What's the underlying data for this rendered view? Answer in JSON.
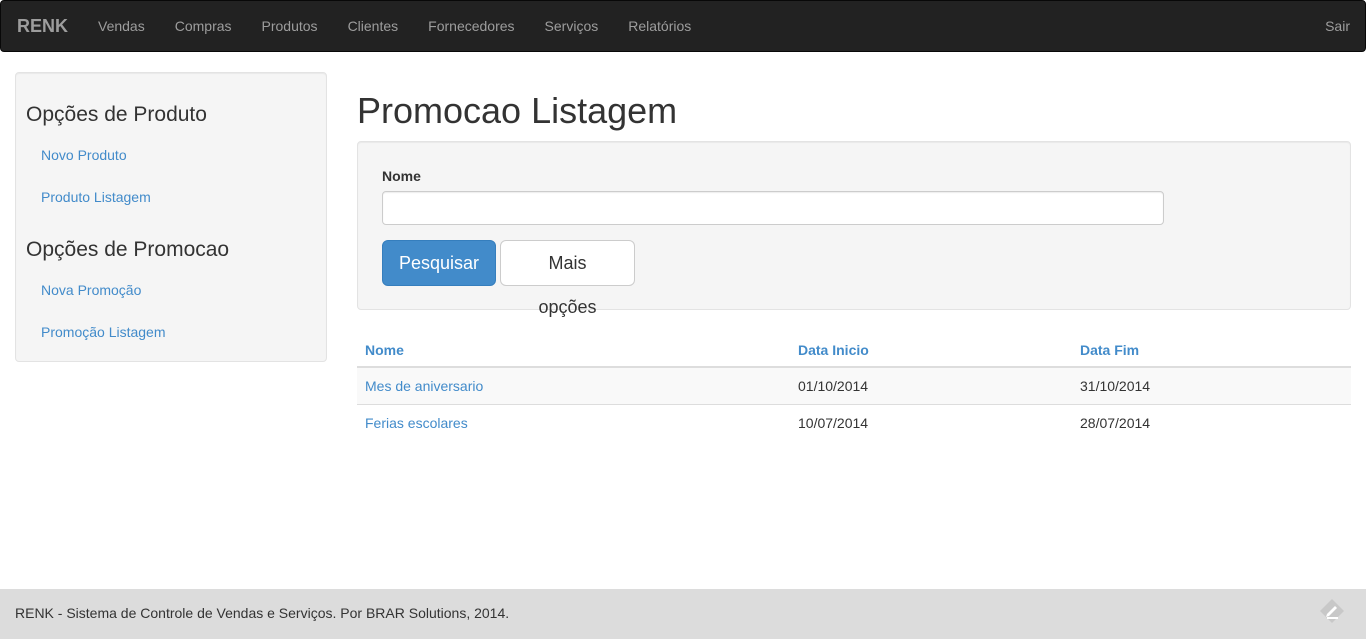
{
  "navbar": {
    "brand": "RENK",
    "links": [
      "Vendas",
      "Compras",
      "Produtos",
      "Clientes",
      "Fornecedores",
      "Serviços",
      "Relatórios"
    ],
    "logout": "Sair"
  },
  "sidebar": {
    "sections": [
      {
        "title": "Opções de Produto",
        "links": [
          "Novo Produto",
          "Produto Listagem"
        ]
      },
      {
        "title": "Opções de Promocao",
        "links": [
          "Nova Promoção",
          "Promoção Listagem"
        ]
      }
    ]
  },
  "main": {
    "title": "Promocao Listagem",
    "search": {
      "label": "Nome",
      "value": "",
      "placeholder": "",
      "search_button": "Pesquisar",
      "more_button": "Mais opções"
    },
    "table": {
      "headers": [
        "Nome",
        "Data Inicio",
        "Data Fim"
      ],
      "rows": [
        [
          "Mes de aniversario",
          "01/10/2014",
          "31/10/2014"
        ],
        [
          "Ferias escolares",
          "10/07/2014",
          "28/07/2014"
        ]
      ]
    }
  },
  "footer": {
    "text": "RENK - Sistema de Controle de Vendas e Serviços. Por BRAR Solutions, 2014.",
    "icon": "feedback-icon"
  },
  "colors": {
    "navbar_bg": "#222222",
    "link": "#428bca",
    "primary_button": "#428bca",
    "footer_bg": "#dcdcdc"
  }
}
